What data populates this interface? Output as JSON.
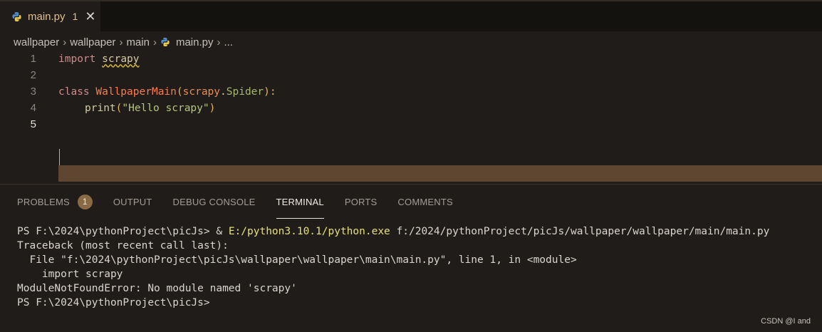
{
  "tab": {
    "file_name": "main.py",
    "problem_count": "1",
    "close_glyph": "✕",
    "icon": "python-icon"
  },
  "breadcrumb": {
    "items": [
      "wallpaper",
      "wallpaper",
      "main",
      "main.py",
      "..."
    ],
    "separator": "›"
  },
  "editor": {
    "lines": [
      {
        "number": "1"
      },
      {
        "number": "2"
      },
      {
        "number": "3"
      },
      {
        "number": "4"
      },
      {
        "number": "5"
      }
    ],
    "code": {
      "l1_kw": "import",
      "l1_mod": "scrapy",
      "l3_kw": "class",
      "l3_cls": "WallpaperMain",
      "l3_open": "(",
      "l3_mod": "scrapy",
      "l3_dot": ".",
      "l3_base": "Spider",
      "l3_close": "):",
      "l4_fn": "print",
      "l4_open": "(",
      "l4_str": "\"Hello scrapy\"",
      "l4_close": ")"
    }
  },
  "panel": {
    "tabs": {
      "problems": "PROBLEMS",
      "problems_count": "1",
      "output": "OUTPUT",
      "debug_console": "DEBUG CONSOLE",
      "terminal": "TERMINAL",
      "ports": "PORTS",
      "comments": "COMMENTS"
    },
    "active_tab": "TERMINAL"
  },
  "terminal": {
    "l1_prompt": "PS F:\\2024\\pythonProject\\picJs> & ",
    "l1_exe": "E:/python3.10.1/python.exe",
    "l1_arg": " f:/2024/pythonProject/picJs/wallpaper/wallpaper/main/main.py",
    "l2": "Traceback (most recent call last):",
    "l3": "  File \"f:\\2024\\pythonProject\\picJs\\wallpaper\\wallpaper\\main\\main.py\", line 1, in <module>",
    "l4": "    import scrapy",
    "l5": "ModuleNotFoundError: No module named 'scrapy'",
    "l6": "PS F:\\2024\\pythonProject\\picJs>"
  },
  "watermark": "CSDN @I and",
  "colors": {
    "background": "#1f1c19",
    "tab_bar": "#14120f",
    "modified_tab_text": "#e2c08d",
    "cursor_line": "#5e4630",
    "badge": "#8a6a45",
    "exe_path": "#e5e07a"
  }
}
